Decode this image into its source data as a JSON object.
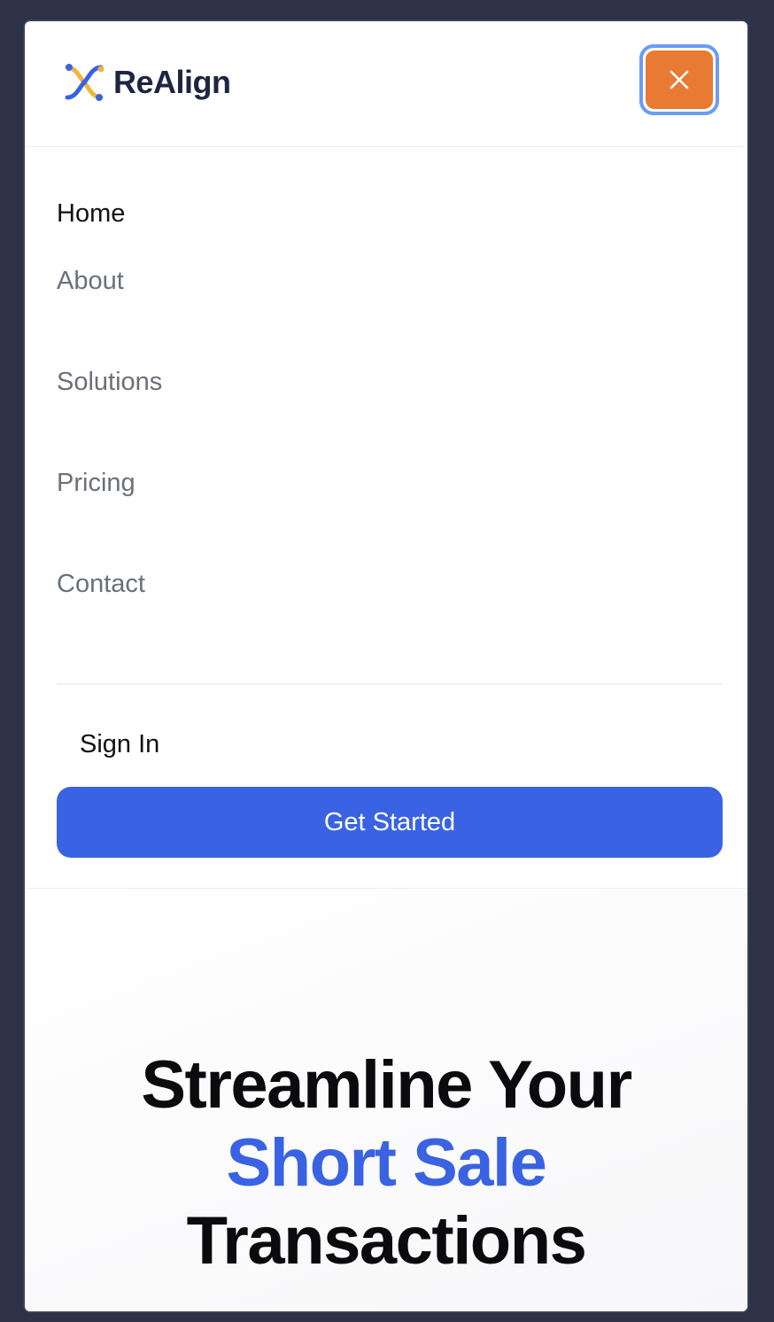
{
  "brand": {
    "name": "ReAlign",
    "logo_icon": "realign-logo-icon",
    "colors": {
      "primary": "#3963e3",
      "close_button": "#e87a33",
      "focus_ring": "#6b9cf5",
      "frame": "#2d3246"
    }
  },
  "header": {
    "close_icon": "close-icon"
  },
  "nav": {
    "items": [
      {
        "label": "Home",
        "active": true
      },
      {
        "label": "About",
        "active": false
      },
      {
        "label": "Solutions",
        "active": false
      },
      {
        "label": "Pricing",
        "active": false
      },
      {
        "label": "Contact",
        "active": false
      }
    ]
  },
  "actions": {
    "signin_label": "Sign In",
    "cta_label": "Get Started"
  },
  "hero": {
    "title_line1": "Streamline Your",
    "title_accent": "Short Sale",
    "title_line3": "Transactions"
  }
}
